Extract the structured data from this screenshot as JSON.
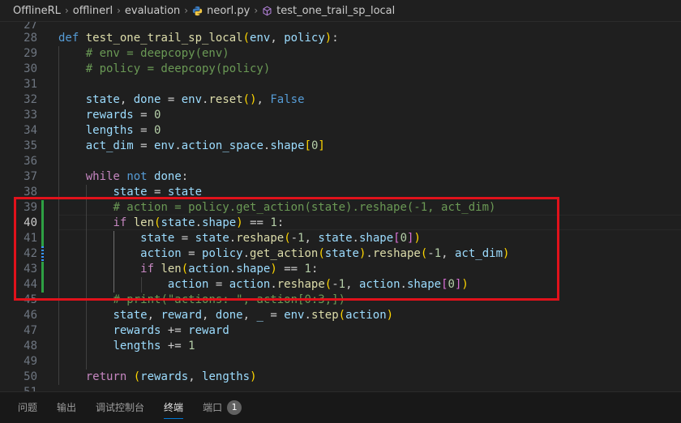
{
  "breadcrumb": {
    "items": [
      "OfflineRL",
      "offlinerl",
      "evaluation",
      "neorl.py",
      "test_one_trail_sp_local"
    ]
  },
  "editor": {
    "line_numbers": [
      "27",
      "28",
      "29",
      "30",
      "31",
      "32",
      "33",
      "34",
      "35",
      "36",
      "37",
      "38",
      "39",
      "40",
      "41",
      "42",
      "43",
      "44",
      "45",
      "46",
      "47",
      "48",
      "49",
      "50",
      "51"
    ],
    "active_line": "40"
  },
  "panel": {
    "tabs": [
      "问题",
      "输出",
      "调试控制台",
      "终端",
      "端口"
    ],
    "active_tab": "终端",
    "ports_badge": "1"
  },
  "colors": {
    "highlight_box": "#e0121b",
    "git_added": "#2ea043",
    "git_modified": "#3794ff",
    "editor_bg": "#1f1f1f"
  },
  "icons": {
    "python_file": "python-icon",
    "function": "symbol-method-icon"
  }
}
